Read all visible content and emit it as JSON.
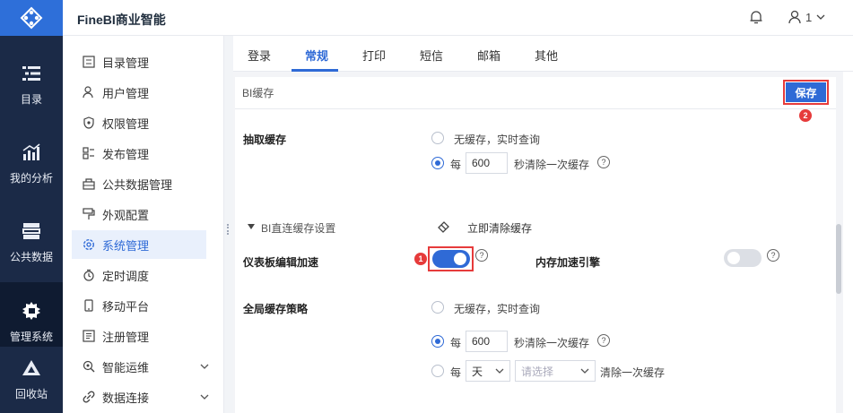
{
  "app": {
    "title": "FineBI商业智能"
  },
  "topbar": {
    "user_label": "1",
    "bell_icon": "bell-icon",
    "user_icon": "user-icon"
  },
  "left_nav": [
    {
      "label": "目录",
      "icon": "catalog-icon"
    },
    {
      "label": "我的分析",
      "icon": "analysis-icon"
    },
    {
      "label": "公共数据",
      "icon": "public-data-icon"
    },
    {
      "label": "管理系统",
      "icon": "gear-icon",
      "active": true
    },
    {
      "label": "回收站",
      "icon": "recycle-icon"
    }
  ],
  "sidebar": {
    "items": [
      {
        "label": "目录管理",
        "icon": "list-icon"
      },
      {
        "label": "用户管理",
        "icon": "user-icon"
      },
      {
        "label": "权限管理",
        "icon": "shield-icon"
      },
      {
        "label": "发布管理",
        "icon": "publish-icon"
      },
      {
        "label": "公共数据管理",
        "icon": "data-icon"
      },
      {
        "label": "外观配置",
        "icon": "brush-icon"
      },
      {
        "label": "系统管理",
        "icon": "gear-icon",
        "active": true
      },
      {
        "label": "定时调度",
        "icon": "clock-icon"
      },
      {
        "label": "移动平台",
        "icon": "mobile-icon"
      },
      {
        "label": "注册管理",
        "icon": "register-icon"
      },
      {
        "label": "智能运维",
        "icon": "ops-icon",
        "expandable": true
      },
      {
        "label": "数据连接",
        "icon": "link-icon",
        "expandable": true
      }
    ]
  },
  "tabs": [
    {
      "label": "登录"
    },
    {
      "label": "常规",
      "active": true
    },
    {
      "label": "打印"
    },
    {
      "label": "短信"
    },
    {
      "label": "邮箱"
    },
    {
      "label": "其他"
    }
  ],
  "section": {
    "title": "BI缓存",
    "save_label": "保存",
    "badge_save": "2",
    "badge_toggle": "1"
  },
  "extract_cache": {
    "label": "抽取缓存",
    "option_none": "无缓存，实时查询",
    "option_every_prefix": "每",
    "seconds_value": "600",
    "option_every_suffix": "秒清除一次缓存"
  },
  "direct_cache": {
    "toggle_label": "BI直连缓存设置",
    "clear_now": "立即清除缓存",
    "dashboard_label": "仪表板编辑加速",
    "dashboard_on": true,
    "memory_label": "内存加速引擎",
    "memory_on": false
  },
  "global_cache": {
    "label": "全局缓存策略",
    "option_none": "无缓存，实时查询",
    "option_every_prefix": "每",
    "seconds_value": "600",
    "option_every_suffix": "秒清除一次缓存",
    "option_period_prefix": "每",
    "period_unit": "天",
    "period_placeholder": "请选择",
    "option_period_suffix": "清除一次缓存"
  },
  "colors": {
    "accent": "#2f6ad6",
    "highlight": "#e63b3b",
    "nav_bg": "#1b2a47"
  }
}
